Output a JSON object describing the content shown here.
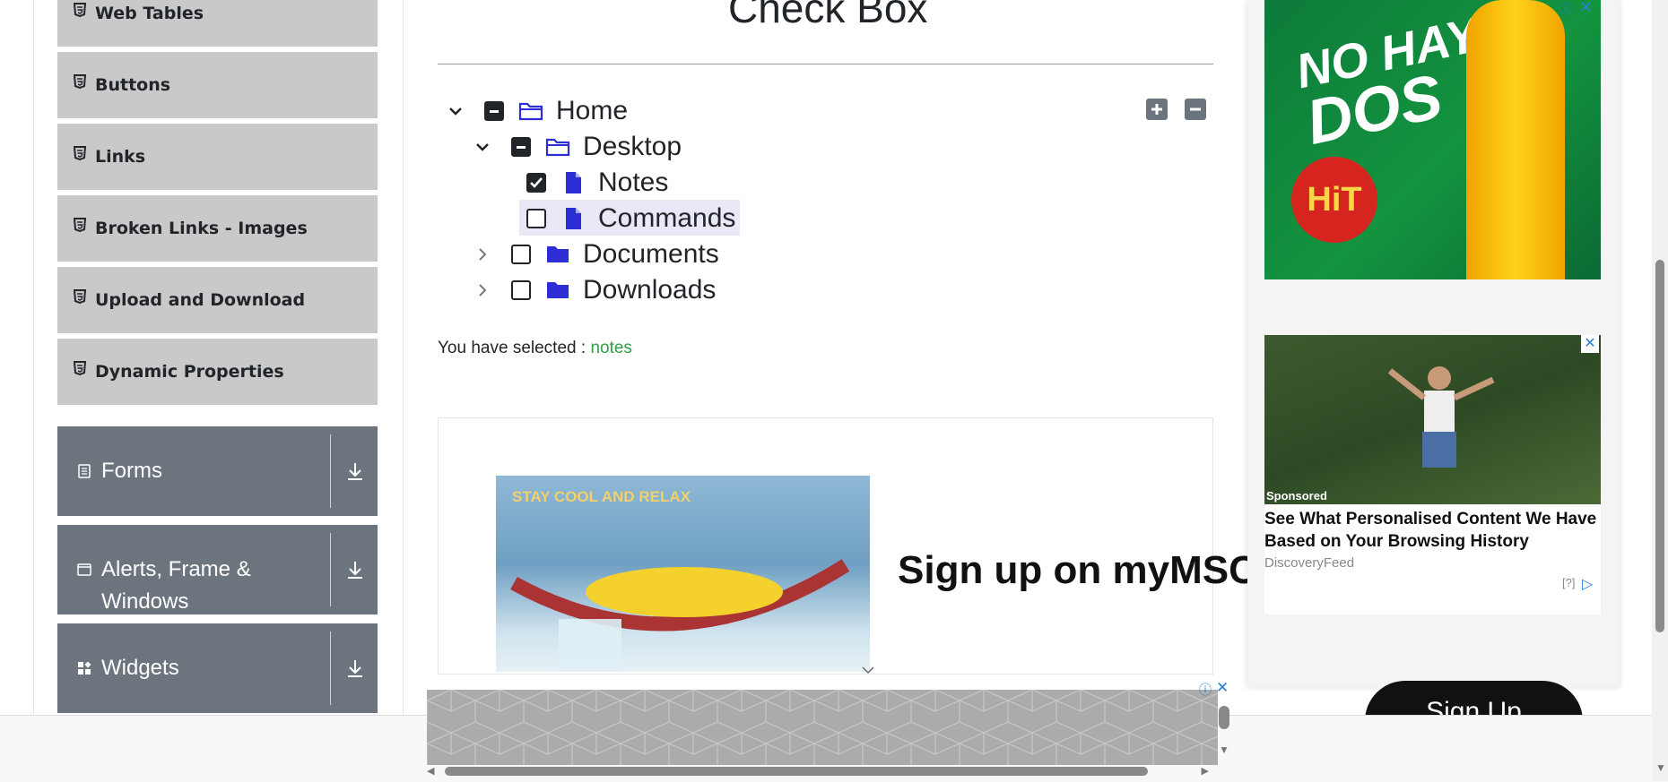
{
  "sidebar": {
    "elements_items": [
      {
        "label": "Web Tables"
      },
      {
        "label": "Buttons"
      },
      {
        "label": "Links"
      },
      {
        "label": "Broken Links - Images"
      },
      {
        "label": "Upload and Download"
      },
      {
        "label": "Dynamic Properties"
      }
    ],
    "groups": [
      {
        "label": "Forms"
      },
      {
        "label": "Alerts, Frame & Windows"
      },
      {
        "label": "Widgets"
      }
    ]
  },
  "main": {
    "title": "Check Box",
    "tree": {
      "home": "Home",
      "desktop": "Desktop",
      "notes": "Notes",
      "commands": "Commands",
      "documents": "Documents",
      "downloads": "Downloads"
    },
    "result_prefix": "You have selected :",
    "result_value": "notes"
  },
  "ads": {
    "banner_tagline": "STAY COOL AND RELAX",
    "banner_headline": "Sign up on myMSC",
    "side_ad1_text1": "NO HAY",
    "side_ad1_text2": "DOS",
    "side_ad1_brand": "HiT",
    "side_ad2_tag": "Sponsored",
    "side_ad2_title": "See What Personalised Content We Have Based on Your Browsing History",
    "side_ad2_source": "DiscoveryFeed",
    "side_ad2_help": "[?]",
    "signup": "Sign Up"
  },
  "colors": {
    "accent_blue": "#2e2ed6",
    "result_green": "#2f9e44",
    "group_bg": "#6c757d",
    "item_bg": "#c9c9c9"
  }
}
